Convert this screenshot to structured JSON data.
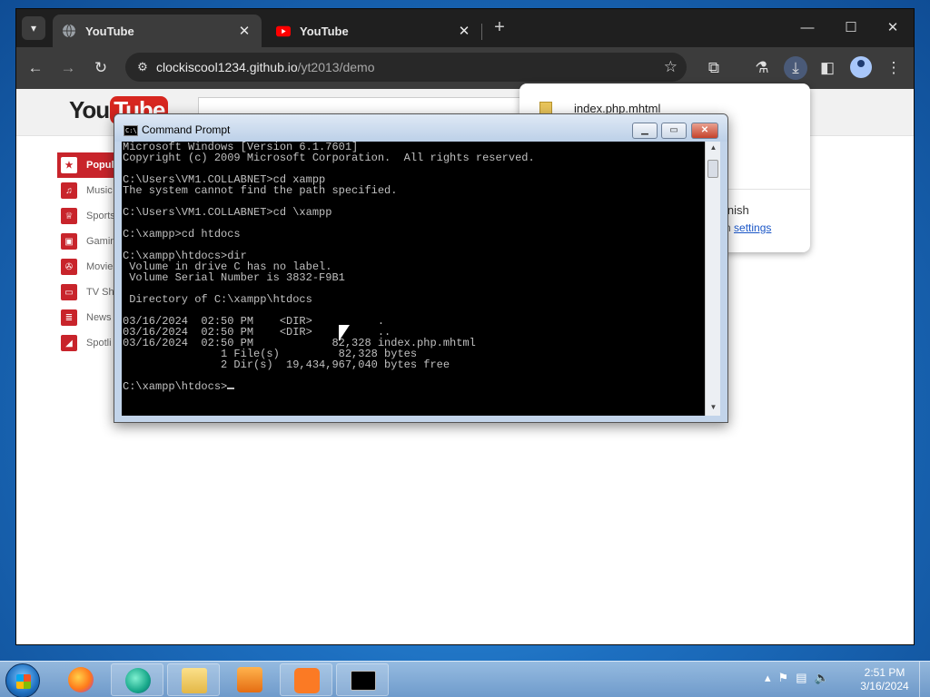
{
  "browser": {
    "tabs": [
      {
        "title": "YouTube",
        "active": true
      },
      {
        "title": "YouTube",
        "active": false
      }
    ],
    "url_host": "clockiscool1234.github.io",
    "url_path": "/yt2013/demo",
    "icons": [
      "tab-search-icon",
      "back-icon",
      "forward-icon",
      "reload-icon",
      "site-info-icon",
      "bookmark-star-icon",
      "extensions-icon",
      "labs-icon",
      "download-icon",
      "side-panel-icon",
      "profile-icon",
      "more-menu-icon"
    ]
  },
  "youtube": {
    "logo_you": "You",
    "logo_tube": "Tube",
    "nav": [
      {
        "label": "Popul",
        "active": true
      },
      {
        "label": "Music"
      },
      {
        "label": "Sports"
      },
      {
        "label": "Gamin"
      },
      {
        "label": "Movie"
      },
      {
        "label": "TV Sh"
      },
      {
        "label": "News"
      },
      {
        "label": "Spotli"
      }
    ]
  },
  "download_bubble": {
    "file_name": "index.php.mhtml",
    "finish_text": "inish",
    "in_text": "n ",
    "settings_link": "settings"
  },
  "cmd": {
    "title": "Command Prompt",
    "icon_text": "C:\\",
    "lines": [
      "Microsoft Windows [Version 6.1.7601]",
      "Copyright (c) 2009 Microsoft Corporation.  All rights reserved.",
      "",
      "C:\\Users\\VM1.COLLABNET>cd xampp",
      "The system cannot find the path specified.",
      "",
      "C:\\Users\\VM1.COLLABNET>cd \\xampp",
      "",
      "C:\\xampp>cd htdocs",
      "",
      "C:\\xampp\\htdocs>dir",
      " Volume in drive C has no label.",
      " Volume Serial Number is 3832-F9B1",
      "",
      " Directory of C:\\xampp\\htdocs",
      "",
      "03/16/2024  02:50 PM    <DIR>          .",
      "03/16/2024  02:50 PM    <DIR>          ..",
      "03/16/2024  02:50 PM            82,328 index.php.mhtml",
      "               1 File(s)         82,328 bytes",
      "               2 Dir(s)  19,434,967,040 bytes free",
      ""
    ],
    "prompt": "C:\\xampp\\htdocs>"
  },
  "taskbar": {
    "items": [
      "firefox",
      "browser-app",
      "file-explorer",
      "media-player",
      "xampp",
      "command-prompt"
    ],
    "time": "2:51 PM",
    "date": "3/16/2024"
  }
}
